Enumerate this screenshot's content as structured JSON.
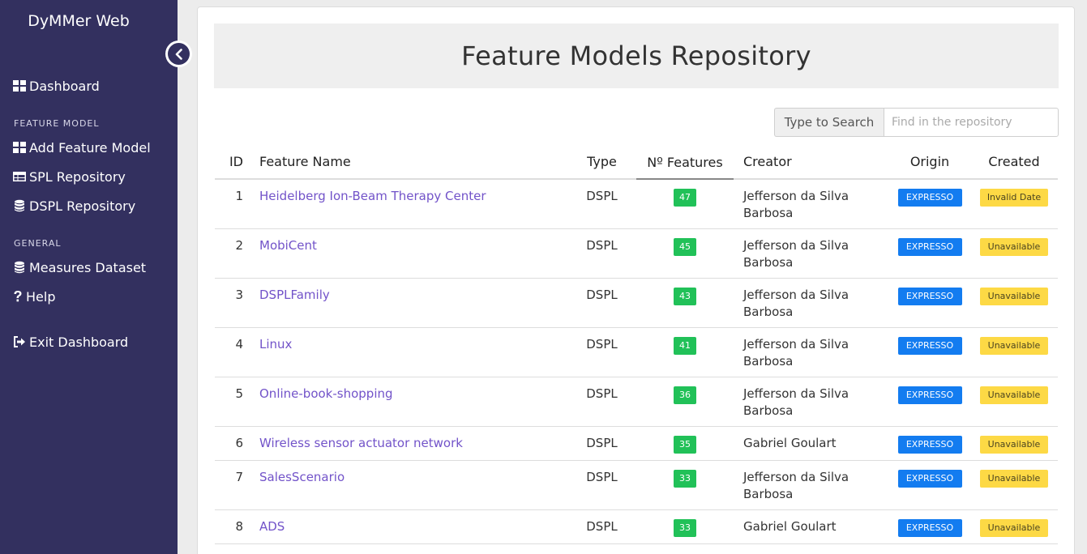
{
  "sidebar": {
    "brand": "DyMMer Web",
    "items": {
      "dashboard": "Dashboard",
      "add_feature_model": "Add Feature Model",
      "spl_repository": "SPL Repository",
      "dspl_repository": "DSPL Repository",
      "measures_dataset": "Measures Dataset",
      "help": "Help",
      "exit_dashboard": "Exit Dashboard"
    },
    "headings": {
      "feature_model": "FEATURE MODEL",
      "general": "GENERAL"
    },
    "colors": {
      "background": "#33305f"
    }
  },
  "main": {
    "title": "Feature Models Repository",
    "search": {
      "label": "Type to Search",
      "placeholder": "Find in the repository"
    },
    "table": {
      "headers": {
        "id": "ID",
        "name": "Feature Name",
        "type": "Type",
        "num_features": "Nº Features",
        "creator": "Creator",
        "origin": "Origin",
        "created": "Created"
      },
      "rows": [
        {
          "id": "1",
          "name": "Heidelberg Ion-Beam Therapy Center",
          "type": "DSPL",
          "features": "47",
          "creator": "Jefferson da Silva Barbosa",
          "origin": "EXPRESSO",
          "created": "Invalid Date"
        },
        {
          "id": "2",
          "name": "MobiCent",
          "type": "DSPL",
          "features": "45",
          "creator": "Jefferson da Silva Barbosa",
          "origin": "EXPRESSO",
          "created": "Unavailable"
        },
        {
          "id": "3",
          "name": "DSPLFamily",
          "type": "DSPL",
          "features": "43",
          "creator": "Jefferson da Silva Barbosa",
          "origin": "EXPRESSO",
          "created": "Unavailable"
        },
        {
          "id": "4",
          "name": "Linux",
          "type": "DSPL",
          "features": "41",
          "creator": "Jefferson da Silva Barbosa",
          "origin": "EXPRESSO",
          "created": "Unavailable"
        },
        {
          "id": "5",
          "name": "Online-book-shopping",
          "type": "DSPL",
          "features": "36",
          "creator": "Jefferson da Silva Barbosa",
          "origin": "EXPRESSO",
          "created": "Unavailable"
        },
        {
          "id": "6",
          "name": "Wireless sensor actuator network",
          "type": "DSPL",
          "features": "35",
          "creator": "Gabriel Goulart",
          "origin": "EXPRESSO",
          "created": "Unavailable"
        },
        {
          "id": "7",
          "name": "SalesScenario",
          "type": "DSPL",
          "features": "33",
          "creator": "Jefferson da Silva Barbosa",
          "origin": "EXPRESSO",
          "created": "Unavailable"
        },
        {
          "id": "8",
          "name": "ADS",
          "type": "DSPL",
          "features": "33",
          "creator": "Gabriel Goulart",
          "origin": "EXPRESSO",
          "created": "Unavailable"
        }
      ]
    },
    "colors": {
      "link": "#7253c9",
      "features_badge": "#21c158",
      "origin_badge": "#137cf0",
      "created_badge": "#fdd945"
    }
  }
}
